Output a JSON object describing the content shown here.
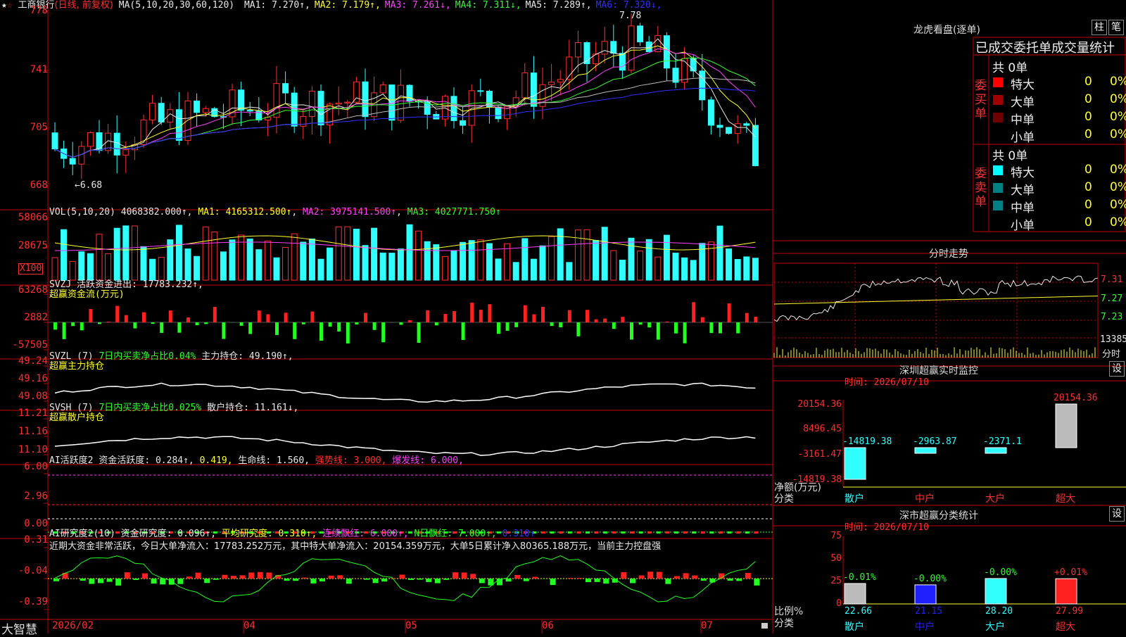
{
  "header": {
    "stock_name": "工商银行",
    "mode": "(日线, 前复权)",
    "ma_params": "MA(5,10,20,30,60,120)",
    "ma_items": [
      {
        "label": "MA1:",
        "value": "7.270",
        "arrow": "↑",
        "color": "#e8e8e8"
      },
      {
        "label": "MA2:",
        "value": "7.179",
        "arrow": "↑",
        "color": "#ffff30"
      },
      {
        "label": "MA3:",
        "value": "7.261",
        "arrow": "↓",
        "color": "#ff40ff"
      },
      {
        "label": "MA4:",
        "value": "7.311",
        "arrow": "↓",
        "color": "#30ff30"
      },
      {
        "label": "MA5:",
        "value": "7.289",
        "arrow": "↑",
        "color": "#e8e8e8"
      },
      {
        "label": "MA6:",
        "value": "7.320",
        "arrow": "↓",
        "color": "#3030ff"
      }
    ]
  },
  "price_axis": [
    "778",
    "741",
    "705",
    "668"
  ],
  "price_high_label": "7.78",
  "price_low_label": "←6.68",
  "vol": {
    "title": "VOL(5,10,20)",
    "value": "4068382.000↑",
    "ma1": "MA1: 4165312.500↑",
    "ma2": "MA2: 3975141.500↑",
    "ma3": "MA3: 4027771.750↑",
    "axis": [
      "58066",
      "28675"
    ],
    "unit": "X100"
  },
  "svzj": {
    "line1": "SVZJ  活跃资金进出: 17783.232↑,",
    "line2": "超赢资金流(万元)",
    "axis": [
      "63268",
      "2882",
      "-57505"
    ]
  },
  "svzl": {
    "prefix": "SVZL (7)",
    "ratio": "7日内买卖净占比0.04%",
    "hold": "主力持仓: 49.190↑,",
    "line2": "超赢主力持仓",
    "axis": [
      "49.24",
      "49.16",
      "49.08"
    ]
  },
  "svsh": {
    "prefix": "SVSH (7)",
    "ratio": "7日内买卖净占比0.025%",
    "hold": "散户持仓: 11.161↓,",
    "line2": "超赢散户持仓",
    "axis": [
      "11.21",
      "11.16",
      "11.10"
    ]
  },
  "ai_active": {
    "title": "AI活跃度2",
    "label": "资金活跃度: 0.284↑,",
    "v2": "0.419,",
    "life": "生命线: 1.560,",
    "strong": "强势线: 3.000,",
    "burst": "爆发线: 6.000,",
    "axis": [
      "6.00",
      "2.96",
      "0.00"
    ]
  },
  "ai_research": {
    "title": "AI研究度2(10)",
    "label": "资金研究度: 0.096↑,",
    "avg": "平均研究度: 0.310↑,",
    "cont": "连续飘红: 6.000↑,",
    "nday": "N日飘红: 7.000↑,",
    "last": "0.310↑",
    "comment": "近期大资金非常活跃，今日大单净流入：17783.252万元，其中特大单净流入：20154.359万元，大单5日累计净入80365.188万元，当前主力控盘强",
    "axis": [
      "0.31",
      "-0.04",
      "-0.39"
    ]
  },
  "x_axis": [
    "2026/02",
    "04",
    "05",
    "06",
    "07"
  ],
  "footer_brand": "大智慧",
  "right": {
    "dragon_title": "龙虎看盘(逐单)",
    "btn_bar": "柱",
    "btn_pen": "笔",
    "stat_title": "已成交委托单成交量统计",
    "buy_label": "委买单",
    "sell_label": "委卖单",
    "buy_total": "共 0单",
    "sell_total": "共 0单",
    "buy_rows": [
      {
        "name": "特大",
        "count": "0",
        "pct": "0%",
        "color": "#ff0000"
      },
      {
        "name": "大单",
        "count": "0",
        "pct": "0%",
        "color": "#a00000"
      },
      {
        "name": "中单",
        "count": "0",
        "pct": "0%",
        "color": "#700000"
      },
      {
        "name": "小单",
        "count": "0",
        "pct": "0%",
        "color": ""
      }
    ],
    "sell_rows": [
      {
        "name": "特大",
        "count": "0",
        "pct": "0%",
        "color": "#00ffff"
      },
      {
        "name": "大单",
        "count": "0",
        "pct": "0%",
        "color": "#008080"
      },
      {
        "name": "中单",
        "count": "0",
        "pct": "0%",
        "color": "#008080"
      },
      {
        "name": "小单",
        "count": "0",
        "pct": "0%",
        "color": ""
      }
    ],
    "minute_title": "分时走势",
    "minute_axis": [
      "7.31",
      "7.27",
      "7.23"
    ],
    "minute_vol": "13385",
    "minute_vol_label": "分时",
    "monitor_title": "深圳超赢实时监控",
    "btn_set": "设",
    "monitor_time": "时间: 2026/07/10",
    "monitor_axis": [
      "20154.36",
      "8496.45",
      "-3161.47",
      "-14819.38"
    ],
    "monitor_values": [
      "-14819.38",
      "-2963.87",
      "-2371.1",
      "20154.36"
    ],
    "monitor_ylabel": "净额(万元)",
    "monitor_xlabel": "分类",
    "categories": [
      "散户",
      "中户",
      "大户",
      "超大"
    ],
    "stat2_title": "深市超赢分类统计",
    "stat2_time": "时间: 2026/07/10",
    "stat2_axis": [
      "75",
      "50",
      "25",
      "0"
    ],
    "stat2_pct": [
      "-0.01%",
      "-0.00%",
      "-0.00%",
      "+0.01%"
    ],
    "stat2_values": [
      "22.66",
      "21.15",
      "28.20",
      "27.99"
    ],
    "stat2_ylabel": "比例%",
    "stat2_xlabel": "分类"
  },
  "chart_data": [
    {
      "type": "bar",
      "title": "深圳超赢实时监控",
      "categories": [
        "散户",
        "中户",
        "大户",
        "超大"
      ],
      "values": [
        -14819.38,
        -2963.87,
        -2371.1,
        20154.36
      ],
      "ylabel": "净额(万元)",
      "ylim": [
        -14819.38,
        20154.36
      ]
    },
    {
      "type": "bar",
      "title": "深市超赢分类统计",
      "categories": [
        "散户",
        "中户",
        "大户",
        "超大"
      ],
      "values": [
        22.66,
        21.15,
        28.2,
        27.99
      ],
      "ylabel": "比例%",
      "ylim": [
        0,
        75
      ]
    }
  ]
}
